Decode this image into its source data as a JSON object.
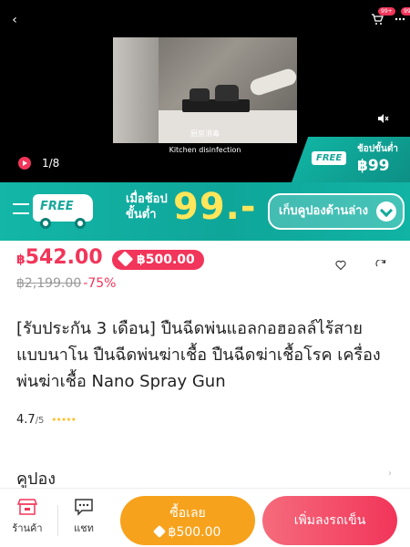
{
  "media": {
    "video_caption": "Kitchen disinfection",
    "video_caption_cn": "厨房消毒",
    "counter": "1/8",
    "cart_badge": "99+",
    "msg_badge": "99+",
    "free_badge": "FREE",
    "free_text": "ช้อปขั้นต่ำ",
    "free_price": "฿99"
  },
  "promo": {
    "free_label": "FREE",
    "min_line1": "เมื่อช้อป",
    "min_line2": "ขั้นต่ำ",
    "min_price": "99.-",
    "coupon_button": "เก็บคูปองด้านล่าง"
  },
  "price": {
    "currency": "฿",
    "current": "542.00",
    "flash_price": "฿500.00",
    "original": "฿2,199.00",
    "discount": "-75%"
  },
  "product": {
    "title": "[รับประกัน 3 เดือน] ปืนฉีดพ่นแอลกอฮอลล์ไร้สาย แบบนาโน ปืนฉีดพ่นฆ่าเชื้อ ปืนฉีดฆ่าเชื้อโรค เครื่องพ่นฆ่าเชื้อ Nano Spray Gun",
    "rating": "4.7",
    "rating_max": "/5",
    "stars": "★★★★★"
  },
  "coupon": {
    "label": "คูปอง",
    "arrow": "›"
  },
  "bottom": {
    "shop_label": "ร้านค้า",
    "chat_label": "แชท",
    "buy_label": "ซื้อเลย",
    "buy_price": "฿500.00",
    "cart_label": "เพิ่มลงรถเข็น"
  },
  "colors": {
    "brand": "#f2355a",
    "teal": "#10b3a4",
    "orange": "#f7a21c",
    "yellow": "#ffe65a"
  }
}
